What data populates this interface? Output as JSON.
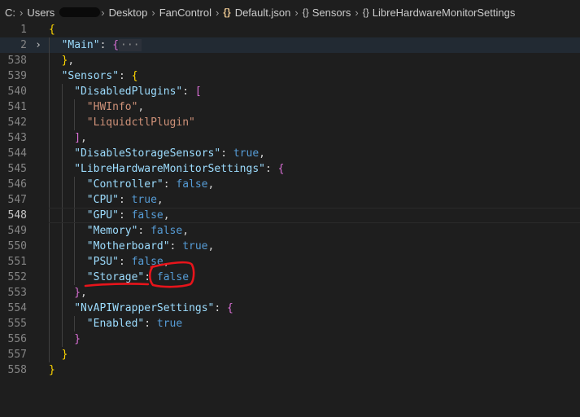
{
  "breadcrumb": {
    "drive": "C:",
    "users": "Users",
    "desktop": "Desktop",
    "fancontrol": "FanControl",
    "file_braces": "{}",
    "file": "Default.json",
    "obj_braces_1": "{}",
    "sensors": "Sensors",
    "obj_braces_2": "{}",
    "lhms": "LibreHardwareMonitorSettings"
  },
  "editor": {
    "lines": [
      {
        "num": "1",
        "fold": "",
        "text": "{"
      },
      {
        "num": "2",
        "fold": "›",
        "text": "\"Main\": {···"
      },
      {
        "num": "538",
        "fold": "",
        "text": "},"
      },
      {
        "num": "539",
        "fold": "",
        "text": "\"Sensors\": {"
      },
      {
        "num": "540",
        "fold": "",
        "text": "\"DisabledPlugins\": ["
      },
      {
        "num": "541",
        "fold": "",
        "text": "\"HWInfo\","
      },
      {
        "num": "542",
        "fold": "",
        "text": "\"LiquidctlPlugin\""
      },
      {
        "num": "543",
        "fold": "",
        "text": "],"
      },
      {
        "num": "544",
        "fold": "",
        "text": "\"DisableStorageSensors\": true,"
      },
      {
        "num": "545",
        "fold": "",
        "text": "\"LibreHardwareMonitorSettings\": {"
      },
      {
        "num": "546",
        "fold": "",
        "text": "\"Controller\": false,"
      },
      {
        "num": "547",
        "fold": "",
        "text": "\"CPU\": true,"
      },
      {
        "num": "548",
        "fold": "",
        "text": "\"GPU\": false,"
      },
      {
        "num": "549",
        "fold": "",
        "text": "\"Memory\": false,"
      },
      {
        "num": "550",
        "fold": "",
        "text": "\"Motherboard\": true,"
      },
      {
        "num": "551",
        "fold": "",
        "text": "\"PSU\": false,"
      },
      {
        "num": "552",
        "fold": "",
        "text": "\"Storage\": false"
      },
      {
        "num": "553",
        "fold": "",
        "text": "},"
      },
      {
        "num": "554",
        "fold": "",
        "text": "\"NvAPIWrapperSettings\": {"
      },
      {
        "num": "555",
        "fold": "",
        "text": "\"Enabled\": true"
      },
      {
        "num": "556",
        "fold": "",
        "text": "}"
      },
      {
        "num": "557",
        "fold": "",
        "text": "}"
      },
      {
        "num": "558",
        "fold": "",
        "text": "}"
      }
    ]
  },
  "colors": {
    "key": "#9cdcfe",
    "string": "#ce9178",
    "boolean": "#569cd6",
    "bracket_level1": "#ffd700",
    "bracket_level2": "#da70d6",
    "bracket_level3": "#179fff",
    "annotation": "#e8141b",
    "background": "#1e1e1e"
  }
}
